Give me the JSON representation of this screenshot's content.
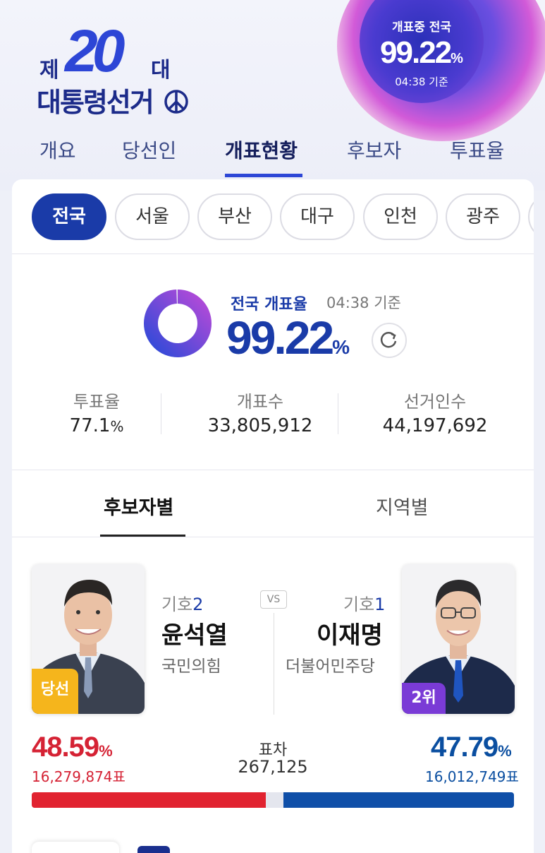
{
  "header": {
    "logo": {
      "prefix": "제",
      "number": "20",
      "suffix": "대",
      "title": "대통령선거"
    },
    "orb": {
      "label": "개표중 전국",
      "percent": "99.22",
      "unit": "%",
      "time": "04:38 기준"
    }
  },
  "nav": {
    "items": [
      {
        "label": "개요"
      },
      {
        "label": "당선인"
      },
      {
        "label": "개표현황",
        "active": true
      },
      {
        "label": "후보자"
      },
      {
        "label": "투표율"
      }
    ]
  },
  "regions": [
    {
      "label": "전국",
      "active": true
    },
    {
      "label": "서울"
    },
    {
      "label": "부산"
    },
    {
      "label": "대구"
    },
    {
      "label": "인천"
    },
    {
      "label": "광주"
    }
  ],
  "status": {
    "label": "전국 개표율",
    "time": "04:38 기준",
    "percent": "99.22",
    "unit": "%",
    "progress": 0.9922,
    "stats": [
      {
        "label": "투표율",
        "value": "77.1",
        "unit": "%"
      },
      {
        "label": "개표수",
        "value": "33,805,912"
      },
      {
        "label": "선거인수",
        "value": "44,197,692"
      }
    ]
  },
  "tabs": [
    {
      "label": "후보자별",
      "active": true
    },
    {
      "label": "지역별"
    }
  ],
  "candidates": {
    "left": {
      "number_prefix": "기호",
      "number": "2",
      "name": "윤석열",
      "party": "국민의힘",
      "badge": "당선",
      "percent": "48.59",
      "unit": "%",
      "votes": "16,279,874표",
      "color": "#d52234"
    },
    "vs": "VS",
    "right": {
      "number_prefix": "기호",
      "number": "1",
      "name": "이재명",
      "party": "더불어민주당",
      "badge": "2위",
      "percent": "47.79",
      "unit": "%",
      "votes": "16,012,749표",
      "color": "#0a4ea0"
    },
    "margin": {
      "label": "표차",
      "value": "267,125"
    },
    "bar": {
      "left_share": 48.59,
      "right_share": 47.79
    }
  },
  "colors": {
    "accent": "#1a3ba8",
    "brand_purple": "#7a3bd6",
    "win_badge": "#f5b51c"
  }
}
